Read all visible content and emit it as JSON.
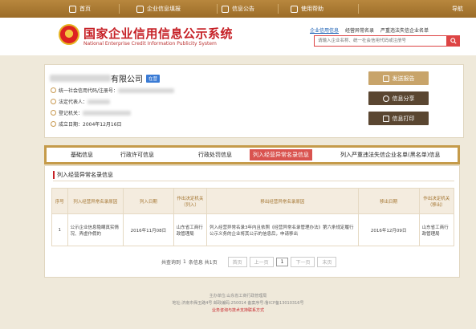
{
  "nav": {
    "items": [
      {
        "label": "首页",
        "icon": "home-icon"
      },
      {
        "label": "企业信息填报",
        "icon": "edit-icon"
      },
      {
        "label": "信息公告",
        "icon": "notice-icon"
      },
      {
        "label": "使用帮助",
        "icon": "help-icon"
      }
    ],
    "guide": "导航"
  },
  "header": {
    "title": "国家企业信用信息公示系统",
    "subtitle": "National Enterprise Credit Information Publicity System",
    "search_tabs": [
      "企业信用信息",
      "经营异常名录",
      "严重违法失信企业名单"
    ],
    "search_placeholder": "请输入企业名称、统一社会信用代码或注册号"
  },
  "company": {
    "name_suffix": "有限公司",
    "status_badge": "在营",
    "fields": [
      {
        "label": "统一社会信用代码/注册号：",
        "value": ""
      },
      {
        "label": "法定代表人：",
        "value": ""
      },
      {
        "label": "登记机关：",
        "value": ""
      },
      {
        "label": "成立日期：",
        "value": "2004年12月16日"
      }
    ]
  },
  "actions": {
    "send_report": "发送报告",
    "share": "信息分享",
    "print": "信息打印"
  },
  "tabs": [
    "基础信息",
    "行政许可信息",
    "行政处罚信息",
    "列入经营异常名录信息",
    "列入严重违法失信企业名单(黑名单)信息"
  ],
  "section": {
    "title": "列入经营异常名录信息",
    "columns": [
      "序号",
      "列入经营异常名录原因",
      "列入日期",
      "作出决定机关（列入）",
      "移出经营异常名录原因",
      "移出日期",
      "作出决定机关（移出）"
    ],
    "rows": [
      [
        "1",
        "公示企业信息隐瞒真实情况、弄虚作假的",
        "2016年11月08日",
        "山东省工商行政管理局",
        "列入经营异常名录3年内且依照《经营异常名录管理办法》第六条规定履行公示义务的企业将其公示的信息后，申请移出",
        "2016年12月09日",
        "山东省工商行政管理局"
      ]
    ]
  },
  "pager": {
    "total_prefix": "共查询到",
    "total_count": "1",
    "total_suffix": "条信息 共1页",
    "first": "首页",
    "prev": "上一页",
    "page": "1",
    "next": "下一页",
    "last": "末页"
  },
  "footer": {
    "line1": "主办单位:山东省工商行政管理局",
    "line2": "地址:济南市舜玉路4号   邮政编码:250014   备案序号:鲁ICP备13010316号",
    "line3": "业务咨询与技术支持联系方式"
  },
  "colors": {
    "brand_red": "#c62127",
    "gold": "#a87a34",
    "selected_tab": "#d9534f"
  }
}
